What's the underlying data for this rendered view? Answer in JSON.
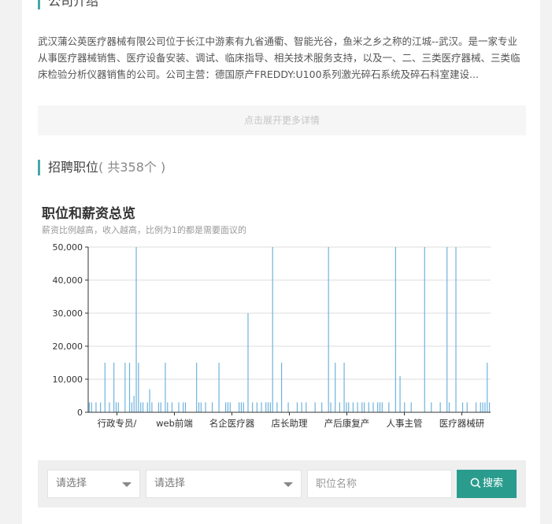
{
  "company": {
    "section_title": "公司介绍",
    "intro": "武汉蒲公英医疗器械有限公司位于长江中游素有九省通衢、智能光谷，鱼米之乡之称的江城--武汉。是一家专业从事医疗器械销售、医疗设备安装、调试、临床指导、相关技术服务支持，以及一、二、三类医疗器械、三类临床检验分析仪器销售的公司。公司主营：德国原产FREDDY:U100系列激光碎石系统及碎石科室建设...",
    "expand_label": "点击展开更多详情"
  },
  "jobs": {
    "section_title": "招聘职位",
    "count_label": "( 共358个 )"
  },
  "chart": {
    "title": "职位和薪资总览",
    "subtitle": "薪资比例越高，收入越高，比例为1的都是需要面议的"
  },
  "chart_data": {
    "type": "bar",
    "ylim": [
      0,
      50000
    ],
    "y_ticks": [
      0,
      10000,
      20000,
      30000,
      40000,
      50000
    ],
    "y_tick_labels": [
      "0",
      "10,000",
      "20,000",
      "30,000",
      "40,000",
      "50,000"
    ],
    "x_tick_labels": [
      "行政专员/",
      "web前端",
      "名企医疗器",
      "店长助理",
      "产后康复产",
      "人事主管",
      "医疗器械研"
    ],
    "grid": true,
    "bar_color": "#6fb3de",
    "values": [
      3000,
      3000,
      0,
      3000,
      0,
      3000,
      0,
      15000,
      0,
      3000,
      0,
      15000,
      3000,
      3000,
      0,
      0,
      15000,
      0,
      15000,
      3000,
      5000,
      50000,
      15000,
      3000,
      3000,
      0,
      3000,
      7000,
      3000,
      0,
      0,
      3000,
      3000,
      0,
      15000,
      3000,
      0,
      3000,
      0,
      0,
      3000,
      0,
      3000,
      3000,
      0,
      0,
      0,
      0,
      15000,
      3000,
      3000,
      0,
      3000,
      0,
      0,
      3000,
      0,
      0,
      15000,
      0,
      0,
      3000,
      3000,
      3000,
      0,
      0,
      0,
      3000,
      3000,
      3000,
      0,
      30000,
      0,
      3000,
      0,
      3000,
      0,
      3000,
      0,
      3000,
      3000,
      3000,
      50000,
      0,
      3000,
      0,
      15000,
      0,
      0,
      3000,
      0,
      0,
      0,
      3000,
      0,
      3000,
      0,
      3000,
      0,
      0,
      0,
      3000,
      0,
      0,
      3000,
      0,
      0,
      50000,
      3000,
      0,
      15000,
      0,
      3000,
      0,
      15000,
      3000,
      3000,
      0,
      3000,
      0,
      3000,
      0,
      3000,
      3000,
      0,
      3000,
      0,
      3000,
      0,
      3000,
      3000,
      3000,
      0,
      0,
      3000,
      0,
      0,
      50000,
      0,
      11000,
      0,
      3000,
      0,
      0,
      3000,
      0,
      0,
      0,
      0,
      0,
      50000,
      0,
      0,
      3000,
      0,
      0,
      0,
      3000,
      0,
      0,
      50000,
      3000,
      0,
      0,
      50000,
      0,
      0,
      3000,
      0,
      3000,
      0,
      0,
      0,
      3000,
      0,
      3000,
      3000,
      3000,
      15000,
      3000
    ]
  },
  "search": {
    "select1_label": "请选择",
    "select2_label": "请选择",
    "keyword_placeholder": "职位名称",
    "button_label": "搜索"
  }
}
